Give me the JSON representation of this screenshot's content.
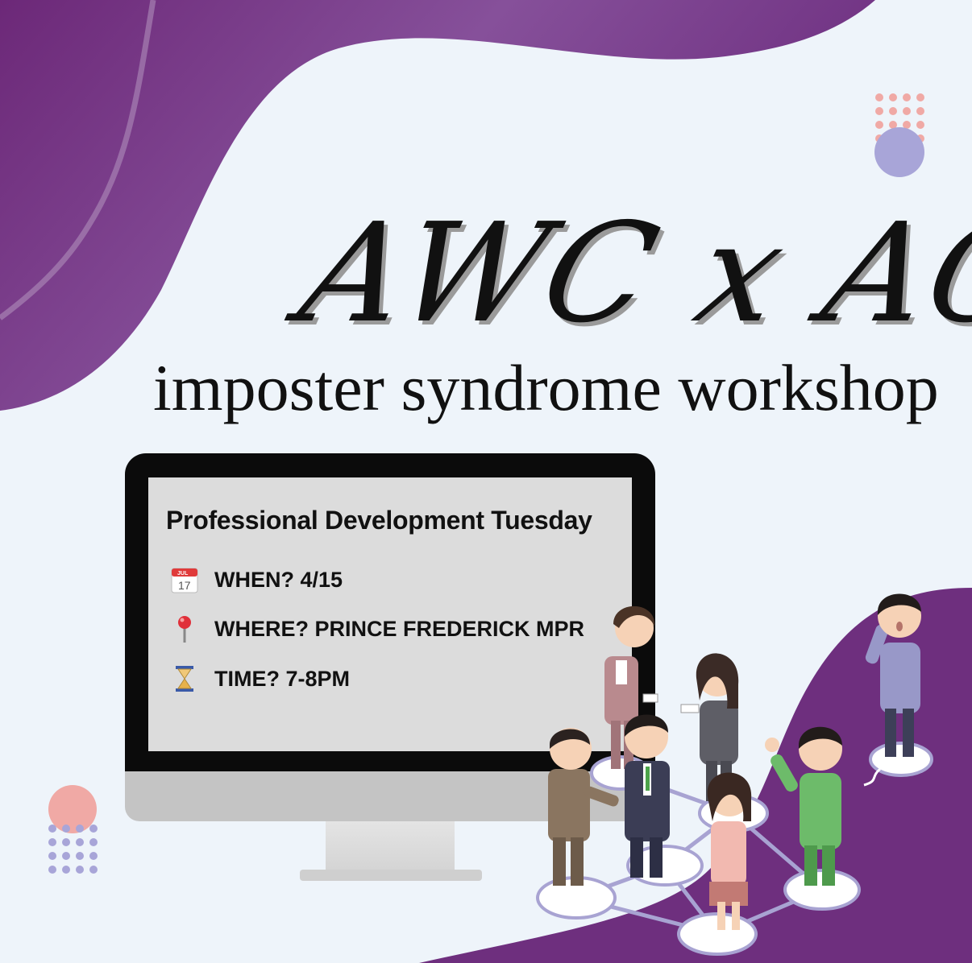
{
  "title_script": "AWC x ACES",
  "subtitle": "imposter syndrome workshop",
  "screen": {
    "heading": "Professional Development Tuesday",
    "rows": [
      {
        "icon": "calendar-icon",
        "text": "WHEN? 4/15"
      },
      {
        "icon": "pin-icon",
        "text": "WHERE? PRINCE FREDERICK MPR"
      },
      {
        "icon": "hourglass-icon",
        "text": "TIME? 7-8PM"
      }
    ],
    "calendar_month": "JUL",
    "calendar_day": "17"
  },
  "colors": {
    "purple": "#6e2f7e",
    "background": "#eef4fa",
    "salmon": "#f0a9a5",
    "lavender": "#a8a5d8",
    "screen": "#dcdcdc"
  }
}
